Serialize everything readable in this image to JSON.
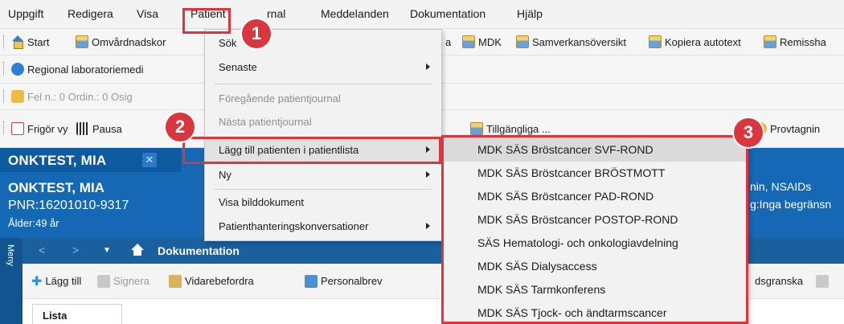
{
  "menubar": {
    "items": [
      "Uppgift",
      "Redigera",
      "Visa",
      "Patient",
      "Journal",
      "Meddelanden",
      "Dokumentation",
      "Hjälp"
    ],
    "journal_visible": "rnal"
  },
  "toolbar1": {
    "start": "Start",
    "omvardnad": "Omvårdnadskor",
    "a_frag": "a",
    "mdk": "MDK",
    "samverkan": "Samverkansöversikt",
    "kopiera": "Kopiera autotext",
    "remiss": "Remissha"
  },
  "toolbar2": {
    "regional": "Regional laboratoriemedi"
  },
  "toolbar3": {
    "status": "Fel n.: 0  Ordin.: 0  Osig"
  },
  "toolbar4": {
    "frigor": "Frigör vy",
    "pausa": "Pausa",
    "tillganglig": "Tillgängliga ...",
    "provtagning": "Provtagnin"
  },
  "patient": {
    "tab_title": "ONKTEST, MIA",
    "close_glyph": "✕",
    "name": "ONKTEST, MIA",
    "pnr": "PNR:16201010-9317",
    "age": "Ålder:49 år",
    "right_line1": "nin, NSAIDs",
    "right_line2": "g:Inga begränsn"
  },
  "nav": {
    "meny": "Meny",
    "title": "Dokumentation"
  },
  "doc_toolbar": {
    "add": "Lägg till",
    "sign": "Signera",
    "forward": "Vidarebefordra",
    "personalbrev": "Personalbrev",
    "review": "dsgranska"
  },
  "list": {
    "header": "Lista"
  },
  "patient_menu": {
    "items": [
      {
        "label": "Sök",
        "disabled": false,
        "submenu": false
      },
      {
        "label": "Senaste",
        "disabled": false,
        "submenu": true
      },
      {
        "label": "Föregående patientjournal",
        "disabled": true,
        "submenu": false
      },
      {
        "label": "Nästa patientjournal",
        "disabled": true,
        "submenu": false
      },
      {
        "label": "Lägg till patienten i patientlista",
        "disabled": false,
        "submenu": true
      },
      {
        "label": "Ny",
        "disabled": false,
        "submenu": true
      },
      {
        "label": "Visa bilddokument",
        "disabled": false,
        "submenu": false
      },
      {
        "label": "Patienthanteringskonversationer",
        "disabled": false,
        "submenu": true
      }
    ]
  },
  "patient_lists": [
    "MDK SÄS Bröstcancer SVF-ROND",
    "MDK SÄS Bröstcancer BRÖSTMOTT",
    "MDK SÄS Bröstcancer  PAD-ROND",
    "MDK SÄS Bröstcancer POSTOP-ROND",
    "SÄS Hematologi- och onkologiavdelning",
    "MDK SÄS Dialysaccess",
    "MDK SÄS Tarmkonferens",
    "MDK SÄS Tjock- och ändtarmscancer"
  ],
  "callouts": [
    "1",
    "2",
    "3"
  ],
  "colors": {
    "patient_banner": "#1468b4",
    "highlight_red": "#d9363e",
    "menu_bg": "#f2f2f2"
  }
}
